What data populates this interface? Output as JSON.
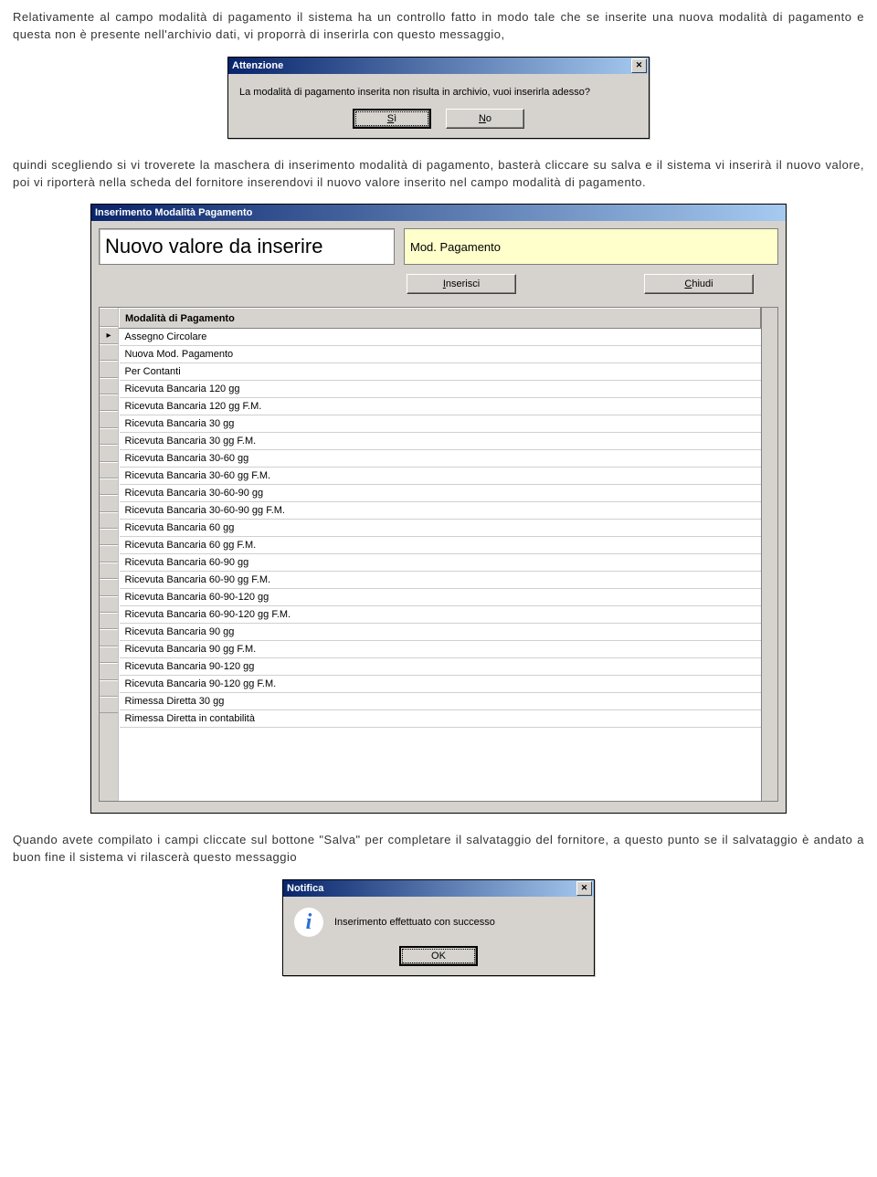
{
  "para1": "Relativamente al campo modalità di pagamento il sistema ha un controllo fatto in modo tale che se inserite una nuova modalità di pagamento e questa non è presente nell'archivio dati, vi proporrà di inserirla con questo messaggio,",
  "attenzione": {
    "title": "Attenzione",
    "text": "La modalità di pagamento inserita non risulta in archivio, vuoi inserirla adesso?",
    "btn_si": "Sì",
    "btn_no": "No"
  },
  "para2": "quindi scegliendo si vi troverete la maschera di inserimento modalità di pagamento, basterà cliccare su salva e il sistema vi inserirà il nuovo valore, poi vi riporterà nella scheda del fornitore inserendovi il nuovo valore inserito nel campo modalità di pagamento.",
  "insmod": {
    "title": "Inserimento Modalità Pagamento",
    "bigfield_label": "Nuovo valore da inserire",
    "yellow_value": "Mod. Pagamento",
    "btn_inserisci": "Inserisci",
    "btn_chiudi": "Chiudi",
    "grid_header": "Modalità di Pagamento",
    "rows": [
      "Assegno Circolare",
      "Nuova Mod. Pagamento",
      "Per Contanti",
      "Ricevuta Bancaria 120 gg",
      "Ricevuta Bancaria 120 gg F.M.",
      "Ricevuta Bancaria 30 gg",
      "Ricevuta Bancaria 30 gg F.M.",
      "Ricevuta Bancaria 30-60 gg",
      "Ricevuta Bancaria 30-60 gg F.M.",
      "Ricevuta Bancaria 30-60-90 gg",
      "Ricevuta Bancaria 30-60-90 gg F.M.",
      "Ricevuta Bancaria 60 gg",
      "Ricevuta Bancaria 60 gg F.M.",
      "Ricevuta Bancaria 60-90 gg",
      "Ricevuta Bancaria 60-90 gg F.M.",
      "Ricevuta Bancaria 60-90-120 gg",
      "Ricevuta Bancaria 60-90-120 gg F.M.",
      "Ricevuta Bancaria 90 gg",
      "Ricevuta Bancaria 90 gg F.M.",
      "Ricevuta Bancaria 90-120 gg",
      "Ricevuta Bancaria 90-120 gg F.M.",
      "Rimessa Diretta 30 gg",
      "Rimessa Diretta in contabilità"
    ]
  },
  "para3": "Quando avete compilato i campi cliccate sul bottone \"Salva\" per completare il salvataggio del fornitore, a questo punto se il salvataggio è andato a buon fine il sistema vi rilascerà questo messaggio",
  "notifica": {
    "title": "Notifica",
    "text": "Inserimento effettuato con successo",
    "btn_ok": "OK"
  }
}
